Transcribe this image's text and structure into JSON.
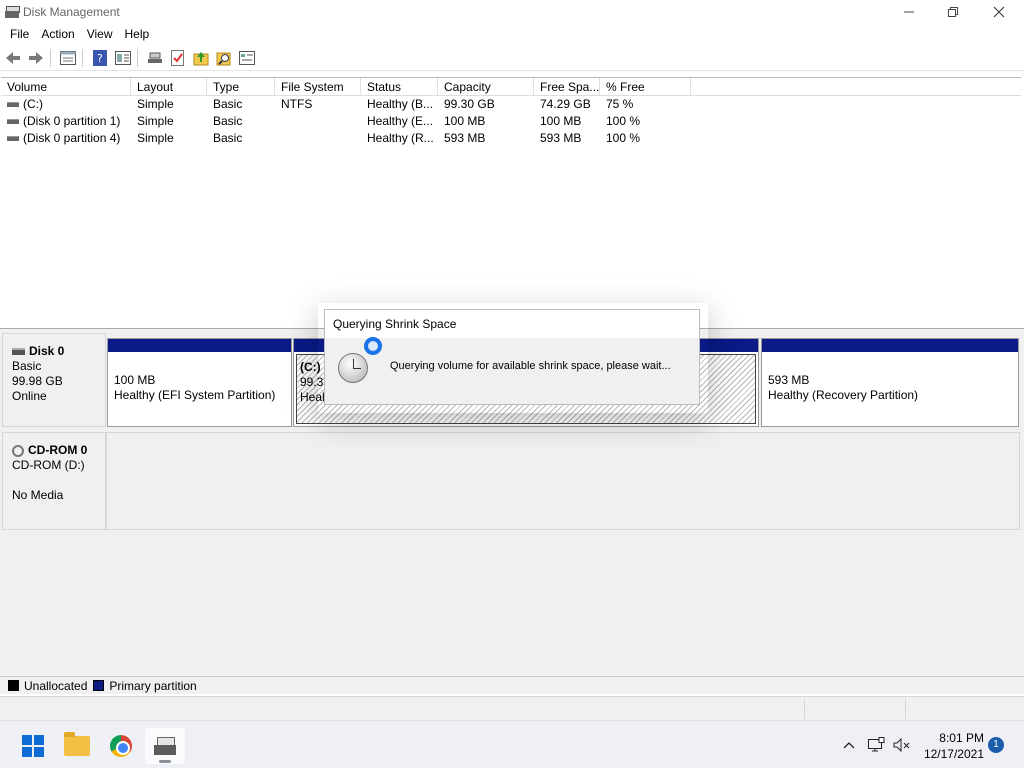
{
  "window": {
    "title": "Disk Management"
  },
  "menu": [
    "File",
    "Action",
    "View",
    "Help"
  ],
  "toolbar_icons": [
    "back-arrow-icon",
    "forward-arrow-icon",
    "properties-icon",
    "help-icon",
    "list-view-icon",
    "connect-icon",
    "check-icon",
    "folder-up-icon",
    "search-icon",
    "settings-icon"
  ],
  "volume_table": {
    "columns": [
      "Volume",
      "Layout",
      "Type",
      "File System",
      "Status",
      "Capacity",
      "Free Spa...",
      "% Free"
    ],
    "rows": [
      [
        "(C:)",
        "Simple",
        "Basic",
        "NTFS",
        "Healthy (B...",
        "99.30 GB",
        "74.29 GB",
        "75 %"
      ],
      [
        "(Disk 0 partition 1)",
        "Simple",
        "Basic",
        "",
        "Healthy (E...",
        "100 MB",
        "100 MB",
        "100 %"
      ],
      [
        "(Disk 0 partition 4)",
        "Simple",
        "Basic",
        "",
        "Healthy (R...",
        "593 MB",
        "593 MB",
        "100 %"
      ]
    ]
  },
  "disks": {
    "disk0": {
      "name": "Disk 0",
      "type": "Basic",
      "size": "99.98 GB",
      "state": "Online"
    },
    "cdrom0": {
      "name": "CD-ROM 0",
      "drive": "CD-ROM (D:)",
      "media": "No Media"
    }
  },
  "partitions": {
    "efi": {
      "size": "100 MB",
      "status": "Healthy (EFI System Partition)"
    },
    "c": {
      "label": "(C:)",
      "size": "99.30",
      "status": "Heal"
    },
    "recovery": {
      "size": "593 MB",
      "status": "Healthy (Recovery Partition)"
    }
  },
  "legend": {
    "unallocated": "Unallocated",
    "primary": "Primary partition"
  },
  "colors": {
    "primary_partition": "#0a1a86",
    "unallocated": "#000000",
    "spinner": "#1a73e8"
  },
  "dialog": {
    "title": "Querying Shrink Space",
    "message": "Querying volume for available shrink space, please wait..."
  },
  "taskbar": {
    "time": "8:01 PM",
    "date": "12/17/2021",
    "notification_count": "1"
  }
}
